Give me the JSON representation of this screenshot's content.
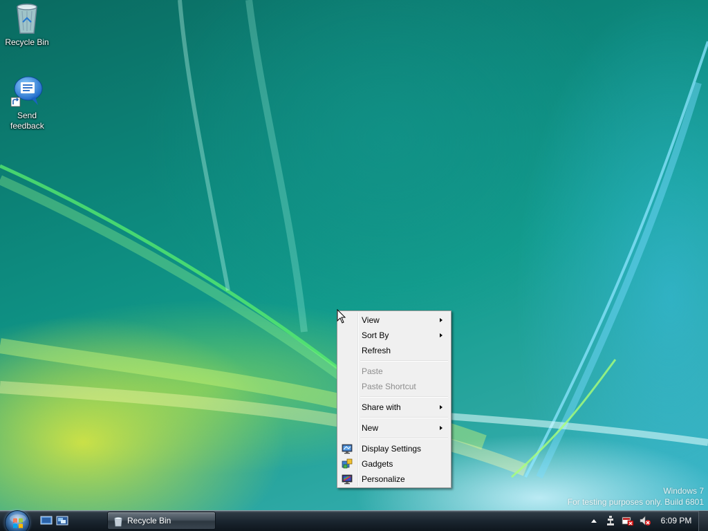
{
  "desktop": {
    "icons": [
      {
        "label": "Recycle Bin",
        "icon": "recycle-bin-icon"
      },
      {
        "label": "Send feedback",
        "icon": "feedback-speech-bubble-icon"
      }
    ],
    "watermark": {
      "line1": "Windows 7",
      "line2": "For testing purposes only. Build 6801"
    }
  },
  "context_menu": {
    "items": [
      {
        "label": "View",
        "submenu": true,
        "disabled": false
      },
      {
        "label": "Sort By",
        "submenu": true,
        "disabled": false
      },
      {
        "label": "Refresh",
        "submenu": false,
        "disabled": false
      },
      {
        "label": "Paste",
        "submenu": false,
        "disabled": true
      },
      {
        "label": "Paste Shortcut",
        "submenu": false,
        "disabled": true
      },
      {
        "label": "Share with",
        "submenu": true,
        "disabled": false
      },
      {
        "label": "New",
        "submenu": true,
        "disabled": false
      },
      {
        "label": "Display Settings",
        "icon": "display-settings-icon",
        "disabled": false
      },
      {
        "label": "Gadgets",
        "icon": "gadgets-icon",
        "disabled": false
      },
      {
        "label": "Personalize",
        "icon": "personalize-icon",
        "disabled": false
      }
    ]
  },
  "taskbar": {
    "start_icon": "windows-orb-icon",
    "quick_launch": [
      "show-desktop-icon",
      "switch-windows-icon"
    ],
    "window_button": {
      "label": "Recycle Bin",
      "icon": "recycle-bin-icon"
    },
    "tray_icons": [
      "show-hidden-icons-arrow",
      "network-icon",
      "action-center-icon",
      "volume-muted-icon"
    ],
    "clock": "6:09 PM"
  },
  "colors": {
    "menu_bg": "#f0f0f0",
    "menu_border": "#979797",
    "disabled_text": "#8d8d8d",
    "taskbar_dark": "#1b2630"
  }
}
